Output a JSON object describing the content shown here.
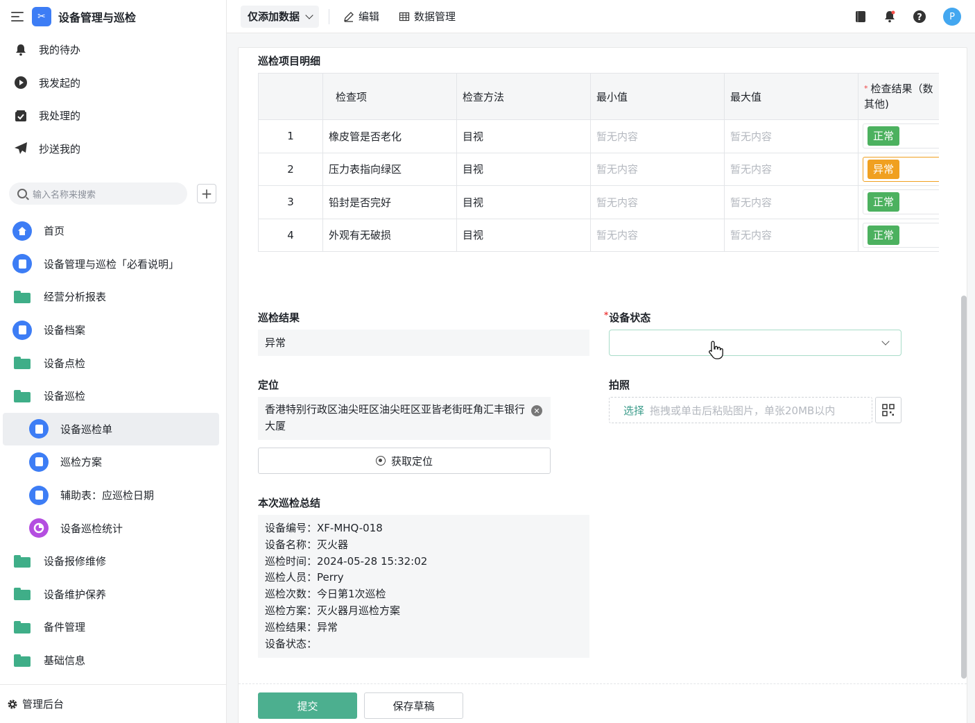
{
  "app": {
    "title": "设备管理与巡检",
    "logo_icon": "tools-icon",
    "accent": "#3d7df5"
  },
  "sidebar": {
    "top_items": [
      {
        "label": "我的待办",
        "icon": "bell-icon"
      },
      {
        "label": "我发起的",
        "icon": "play-circle-icon"
      },
      {
        "label": "我处理的",
        "icon": "check-box-icon"
      },
      {
        "label": "抄送我的",
        "icon": "send-icon"
      }
    ],
    "search_placeholder": "输入名称来搜索",
    "nav": [
      {
        "label": "首页",
        "icon": "home-icon",
        "level": 0
      },
      {
        "label": "设备管理与巡检「必看说明」",
        "icon": "document-icon",
        "level": 0
      },
      {
        "label": "经营分析报表",
        "icon": "folder-icon",
        "level": 0
      },
      {
        "label": "设备档案",
        "icon": "document-icon",
        "level": 0
      },
      {
        "label": "设备点检",
        "icon": "folder-icon",
        "level": 0
      },
      {
        "label": "设备巡检",
        "icon": "folder-open-icon",
        "level": 0
      },
      {
        "label": "设备巡检单",
        "icon": "document-icon",
        "level": 1,
        "active": true
      },
      {
        "label": "巡检方案",
        "icon": "document-icon",
        "level": 1
      },
      {
        "label": "辅助表：应巡检日期",
        "icon": "document-icon",
        "level": 1
      },
      {
        "label": "设备巡检统计",
        "icon": "pie-chart-icon",
        "level": 1
      },
      {
        "label": "设备报修维修",
        "icon": "folder-icon",
        "level": 0
      },
      {
        "label": "设备维护保养",
        "icon": "folder-icon",
        "level": 0
      },
      {
        "label": "备件管理",
        "icon": "folder-icon",
        "level": 0
      },
      {
        "label": "基础信息",
        "icon": "folder-icon",
        "level": 0
      }
    ],
    "footer_label": "管理后台"
  },
  "topbar": {
    "view_select": "仅添加数据",
    "edit_label": "编辑",
    "data_manage_label": "数据管理",
    "avatar_letter": "P"
  },
  "form": {
    "detail_title": "巡检项目明细",
    "table": {
      "headers": [
        "",
        "检查项",
        "检查方法",
        "最小值",
        "最大值",
        "检查结果（数",
        "其他)"
      ],
      "rows": [
        {
          "no": "1",
          "item": "橡皮管是否老化",
          "method": "目视",
          "min": "暂无内容",
          "max": "暂无内容",
          "result": "正常"
        },
        {
          "no": "2",
          "item": "压力表指向绿区",
          "method": "目视",
          "min": "暂无内容",
          "max": "暂无内容",
          "result": "异常"
        },
        {
          "no": "3",
          "item": "铅封是否完好",
          "method": "目视",
          "min": "暂无内容",
          "max": "暂无内容",
          "result": "正常"
        },
        {
          "no": "4",
          "item": "外观有无破损",
          "method": "目视",
          "min": "暂无内容",
          "max": "暂无内容",
          "result": "正常"
        }
      ]
    },
    "result_label": "巡检结果",
    "result_value": "异常",
    "status_label": "设备状态",
    "status_value": "",
    "location_label": "定位",
    "location_value": "香港特别行政区油尖旺区油尖旺区亚皆老街旺角汇丰银行大厦",
    "location_button": "获取定位",
    "photo_label": "拍照",
    "photo_select": "选择",
    "photo_hint": "拖拽或单击后粘贴图片，单张20MB以内",
    "summary_label": "本次巡检总结",
    "summary_lines": [
      "设备编号：XF-MHQ-018",
      "设备名称：灭火器",
      "巡检时间：2024-05-28 15:32:02",
      "巡检人员：Perry",
      "巡检次数：今日第1次巡检",
      "巡检方案：灭火器月巡检方案",
      "巡检结果：异常",
      "设备状态："
    ],
    "submit_label": "提交",
    "draft_label": "保存草稿",
    "colors": {
      "ok": "#4cb15f",
      "bad": "#f0a020",
      "primary": "#4caf8f"
    }
  }
}
